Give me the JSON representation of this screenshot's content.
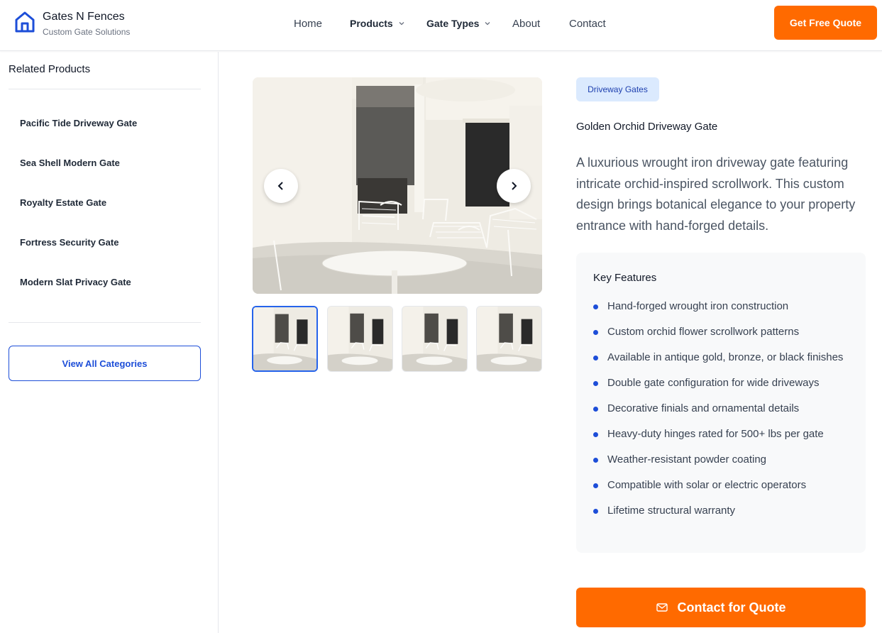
{
  "header": {
    "brand_name": "Gates N Fences",
    "brand_tagline": "Custom Gate Solutions",
    "logo_icon": "house-icon",
    "nav": [
      {
        "label": "Home"
      },
      {
        "label": "Products",
        "dropdown": true
      },
      {
        "label": "Gate Types",
        "dropdown": true
      },
      {
        "label": "About"
      },
      {
        "label": "Contact"
      }
    ],
    "cta_label": "Get Free Quote"
  },
  "sidebar": {
    "title": "Related Products",
    "items": [
      {
        "label": "Pacific Tide Driveway Gate"
      },
      {
        "label": "Sea Shell Modern Gate"
      },
      {
        "label": "Royalty Estate Gate"
      },
      {
        "label": "Fortress Security Gate"
      },
      {
        "label": "Modern Slat Privacy Gate"
      }
    ],
    "view_all_label": "View All Categories"
  },
  "gallery": {
    "prev_icon": "chevron-left-icon",
    "next_icon": "chevron-right-icon",
    "thumbnail_count": 4,
    "active_thumbnail": 1
  },
  "product": {
    "badge": "Driveway Gates",
    "title": "Golden Orchid Driveway Gate",
    "description": "A luxurious wrought iron driveway gate featuring intricate orchid-inspired scrollwork. This custom design brings botanical elegance to your property entrance with hand-forged details.",
    "features_title": "Key Features",
    "features": [
      "Hand-forged wrought iron construction",
      "Custom orchid flower scrollwork patterns",
      "Available in antique gold, bronze, or black finishes",
      "Double gate configuration for wide driveways",
      "Decorative finials and ornamental details",
      "Heavy-duty hinges rated for 500+ lbs per gate",
      "Weather-resistant powder coating",
      "Compatible with solar or electric operators",
      "Lifetime structural warranty"
    ],
    "contact_label": "Contact for Quote",
    "contact_icon": "mail-icon"
  },
  "colors": {
    "accent_orange": "#ff6a00",
    "brand_blue": "#1d4ed8",
    "badge_bg": "#dbeafe"
  }
}
